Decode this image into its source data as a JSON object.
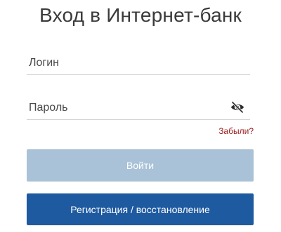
{
  "title": "Вход в Интернет-банк",
  "login": {
    "placeholder": "Логин",
    "value": ""
  },
  "password": {
    "placeholder": "Пароль",
    "value": "",
    "visibility_icon": "eye-off-icon"
  },
  "forgot_link": "Забыли?",
  "login_button": "Войти",
  "register_button": "Регистрация / восстановление",
  "colors": {
    "accent": "#1e5aa0",
    "disabled_button": "#a9c2d7",
    "link": "#9b1c1c"
  }
}
